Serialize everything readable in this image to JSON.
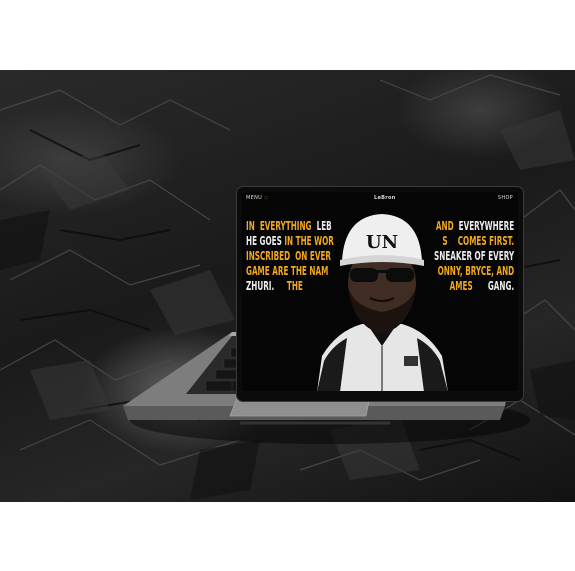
{
  "nav": {
    "menu_label": "MENU",
    "menu_dots": "::",
    "logo": "LeBron",
    "shop_label": "SHOP"
  },
  "cap_text": "UN",
  "left_lines": [
    [
      {
        "t": "IN",
        "c": "y"
      },
      {
        "t": "EVERYTHING",
        "c": "y"
      },
      {
        "t": "LEB",
        "c": "c"
      }
    ],
    [
      {
        "t": "HE GOES",
        "c": "c"
      },
      {
        "t": "IN THE WOR",
        "c": "y"
      }
    ],
    [
      {
        "t": "INSCRIBED",
        "c": "y"
      },
      {
        "t": "ON EVER",
        "c": "y"
      }
    ],
    [
      {
        "t": "GAME ARE THE NAM",
        "c": "y"
      }
    ],
    [
      {
        "t": "ZHURI.",
        "c": "c"
      },
      {
        "t": "THE",
        "c": "y"
      }
    ]
  ],
  "right_lines": [
    [
      {
        "t": "AND",
        "c": "y"
      },
      {
        "t": "EVERYWHERE",
        "c": "c"
      }
    ],
    [
      {
        "t": "S",
        "c": "y"
      },
      {
        "t": "COMES FIRST.",
        "c": "y"
      }
    ],
    [
      {
        "t": "SNEAKER OF EVERY",
        "c": "c"
      }
    ],
    [
      {
        "t": "ONNY, BRYCE, AND",
        "c": "y"
      }
    ],
    [
      {
        "t": "AMES",
        "c": "y"
      },
      {
        "t": "GANG.",
        "c": "c"
      }
    ]
  ],
  "colors": {
    "accent": "#f2a81d",
    "text": "#ececec",
    "screen_bg": "#050505",
    "laptop_body": "#8e8e8e"
  },
  "icons": [
    "rock-background",
    "laptop",
    "keyboard",
    "trackpad"
  ]
}
